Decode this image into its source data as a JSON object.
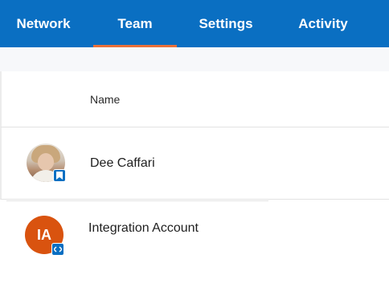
{
  "nav": {
    "tabs": [
      {
        "label": "Network"
      },
      {
        "label": "Team"
      },
      {
        "label": "Settings"
      },
      {
        "label": "Activity"
      }
    ],
    "active_tab": "Team",
    "bar_color": "#0a6fc2",
    "underline_color": "#e8703a"
  },
  "list": {
    "header": {
      "name_label": "Name"
    },
    "rows": [
      {
        "name": "Dee Caffari",
        "avatar": "photo",
        "badge_icon": "bookmark-icon"
      },
      {
        "name": "Integration Account",
        "avatar_initials": "IA",
        "avatar_color": "#d9530f",
        "badge_icon": "code-icon"
      }
    ]
  }
}
